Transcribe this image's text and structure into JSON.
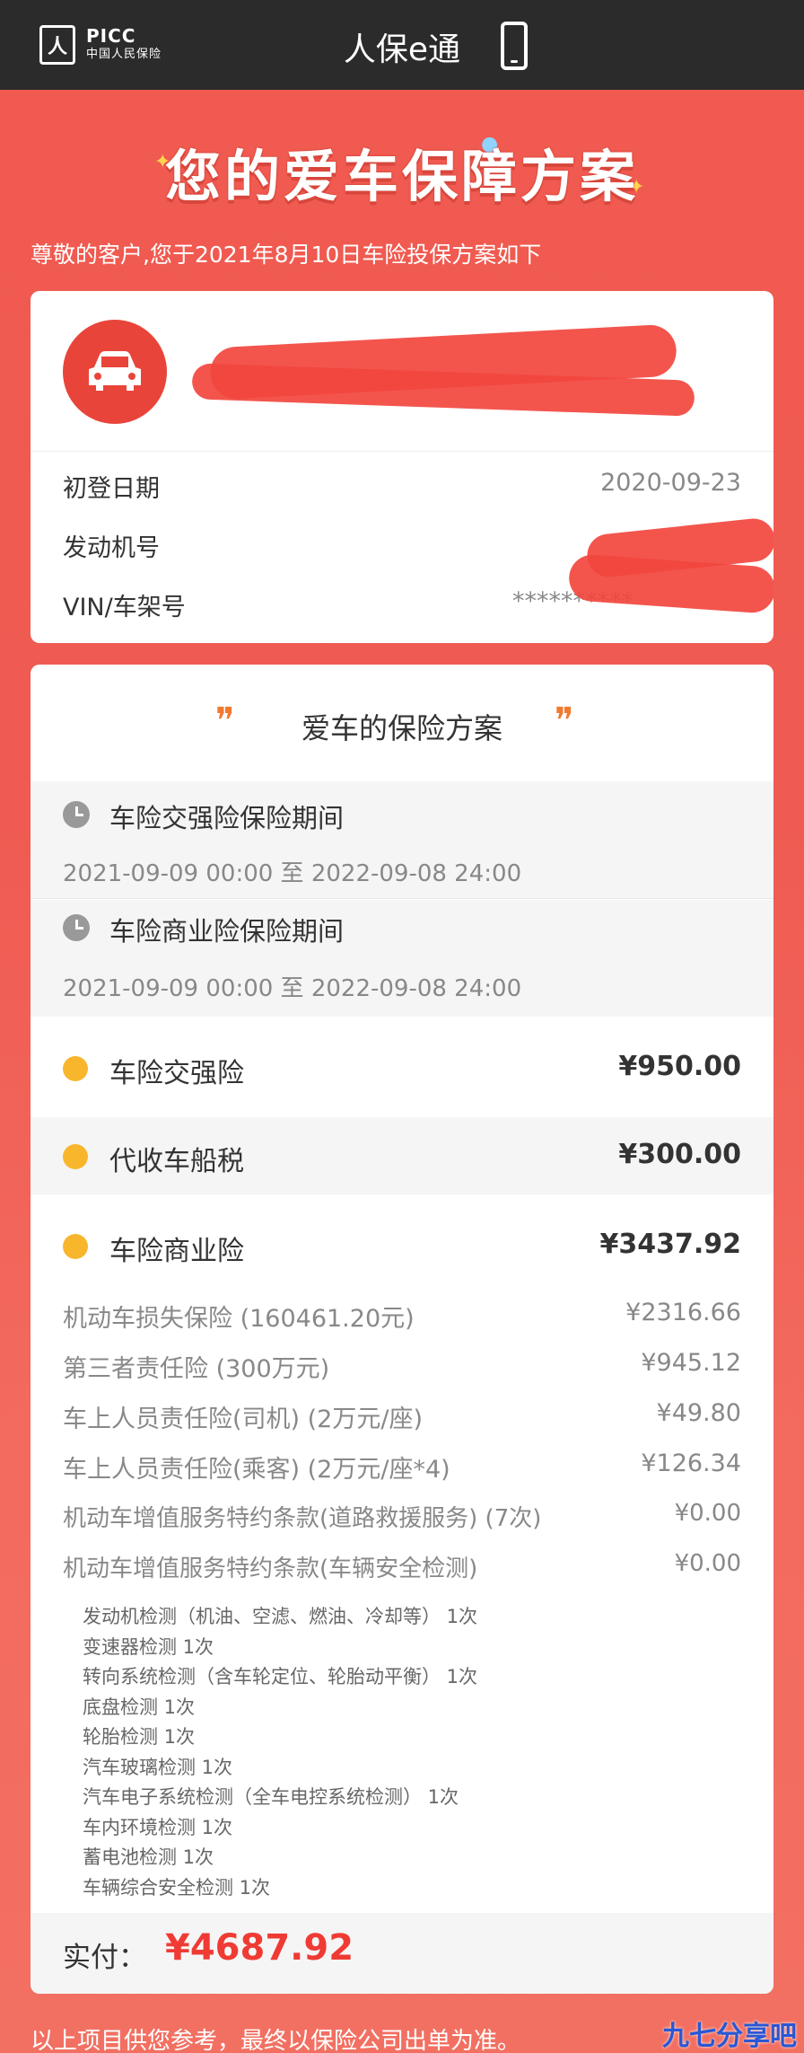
{
  "topbar": {
    "logo_mark": "人",
    "logo_picc": "PICC",
    "logo_cn": "中国人民保险",
    "title": "人保e通"
  },
  "banner": {
    "title": "您的爱车保障方案",
    "greeting": "尊敬的客户,您于2021年8月10日车险投保方案如下"
  },
  "vehicle": {
    "rows": [
      {
        "label": "初登日期",
        "value": "2020-09-23"
      },
      {
        "label": "发动机号",
        "value": ""
      },
      {
        "label": "VIN/车架号",
        "value": "**********"
      }
    ]
  },
  "plan": {
    "title": "爱车的保险方案",
    "quote_mark": "❞",
    "periods": [
      {
        "label": "车险交强险保险期间",
        "value": "2021-09-09 00:00 至 2022-09-08 24:00"
      },
      {
        "label": "车险商业险保险期间",
        "value": "2021-09-09 00:00 至 2022-09-08 24:00"
      }
    ],
    "fees": [
      {
        "label": "车险交强险",
        "amount": "¥950.00"
      },
      {
        "label": "代收车船税",
        "amount": "¥300.00"
      },
      {
        "label": "车险商业险",
        "amount": "¥3437.92"
      }
    ],
    "commercial_items": [
      {
        "label": "机动车损失保险 (160461.20元)",
        "amount": "¥2316.66"
      },
      {
        "label": "第三者责任险 (300万元)",
        "amount": "¥945.12"
      },
      {
        "label": "车上人员责任险(司机) (2万元/座)",
        "amount": "¥49.80"
      },
      {
        "label": "车上人员责任险(乘客) (2万元/座*4)",
        "amount": "¥126.34"
      },
      {
        "label": "机动车增值服务特约条款(道路救援服务) (7次)",
        "amount": "¥0.00"
      },
      {
        "label": "机动车增值服务特约条款(车辆安全检测)",
        "amount": "¥0.00"
      }
    ],
    "checks": [
      "发动机检测（机油、空滤、燃油、冷却等） 1次",
      "变速器检测 1次",
      "转向系统检测（含车轮定位、轮胎动平衡） 1次",
      "底盘检测 1次",
      "轮胎检测 1次",
      "汽车玻璃检测 1次",
      "汽车电子系统检测（全车电控系统检测） 1次",
      "车内环境检测 1次",
      "蓄电池检测 1次",
      "车辆综合安全检测 1次"
    ],
    "total_label": "实付：",
    "total_value": "¥4687.92"
  },
  "footer": {
    "note": "以上项目供您参考，最终以保险公司出单为准。",
    "watermark": "九七分享吧"
  },
  "colors": {
    "brand_red": "#ef3b34",
    "accent_yellow": "#f8b62d",
    "topbar": "#2b2b2b"
  }
}
